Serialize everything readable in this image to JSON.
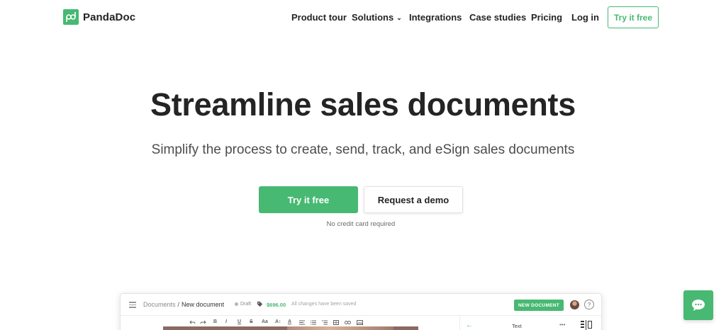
{
  "brand": {
    "name": "PandaDoc",
    "accent": "#47b972"
  },
  "nav": {
    "items": [
      {
        "label": "Product tour"
      },
      {
        "label": "Solutions"
      },
      {
        "label": "Integrations"
      },
      {
        "label": "Case studies"
      },
      {
        "label": "Pricing"
      },
      {
        "label": "Log in"
      }
    ],
    "cta": "Try it free",
    "solutions_icon": "chevron-down-icon"
  },
  "hero": {
    "title": "Streamline sales documents",
    "subtitle": "Simplify the process to create, send, track, and eSign sales documents",
    "primary_cta": "Try it free",
    "secondary_cta": "Request a demo",
    "note": "No credit card required"
  },
  "app_preview": {
    "breadcrumb_root": "Documents",
    "breadcrumb_separator": "/",
    "breadcrumb_current": "New document",
    "status": "Draft",
    "price": "$696.00",
    "save_status": "All changes have been saved",
    "new_document_button": "NEW DOCUMENT",
    "help_icon_text": "?",
    "toolbar_items": [
      "undo-icon",
      "redo-icon",
      "B",
      "I",
      "U",
      "S",
      "Aa",
      "A↕",
      "A",
      "align-icon",
      "list-icon",
      "numbered-list-icon",
      "table-icon",
      "link-icon",
      "image-icon"
    ],
    "side_panel_title": "Text",
    "side_panel_more": "•••"
  },
  "chat": {
    "icon": "chat-bubble-icon"
  }
}
